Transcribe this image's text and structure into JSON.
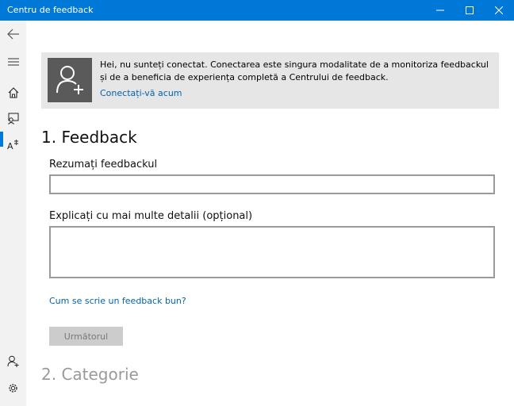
{
  "window": {
    "title": "Centru de feedback"
  },
  "sidebar": {
    "items": [
      {
        "icon": "back-arrow-icon"
      },
      {
        "icon": "hamburger-icon"
      },
      {
        "icon": "home-icon"
      },
      {
        "icon": "feedback-icon",
        "active": true
      },
      {
        "icon": "announcements-icon"
      },
      {
        "icon": "account-add-icon"
      },
      {
        "icon": "gear-icon"
      }
    ]
  },
  "banner": {
    "message": "Hei, nu sunteți conectat. Conectarea este singura modalitate de a monitoriza feedbackul și de a beneficia de experiența completă a Centrului de feedback.",
    "link": "Conectați-vă acum"
  },
  "feedback": {
    "section_title": "1. Feedback",
    "summary_label": "Rezumați feedbackul",
    "summary_value": "",
    "details_label": "Explicați cu mai multe detalii (opțional)",
    "details_value": "",
    "help_link": "Cum se scrie un feedback bun?",
    "next_button": "Următorul"
  },
  "category": {
    "section_title": "2. Categorie"
  },
  "colors": {
    "accent": "#0078d7",
    "link": "#0063b1",
    "banner_bg": "#e6e6e6",
    "sidebar_bg": "#f2f2f2"
  }
}
